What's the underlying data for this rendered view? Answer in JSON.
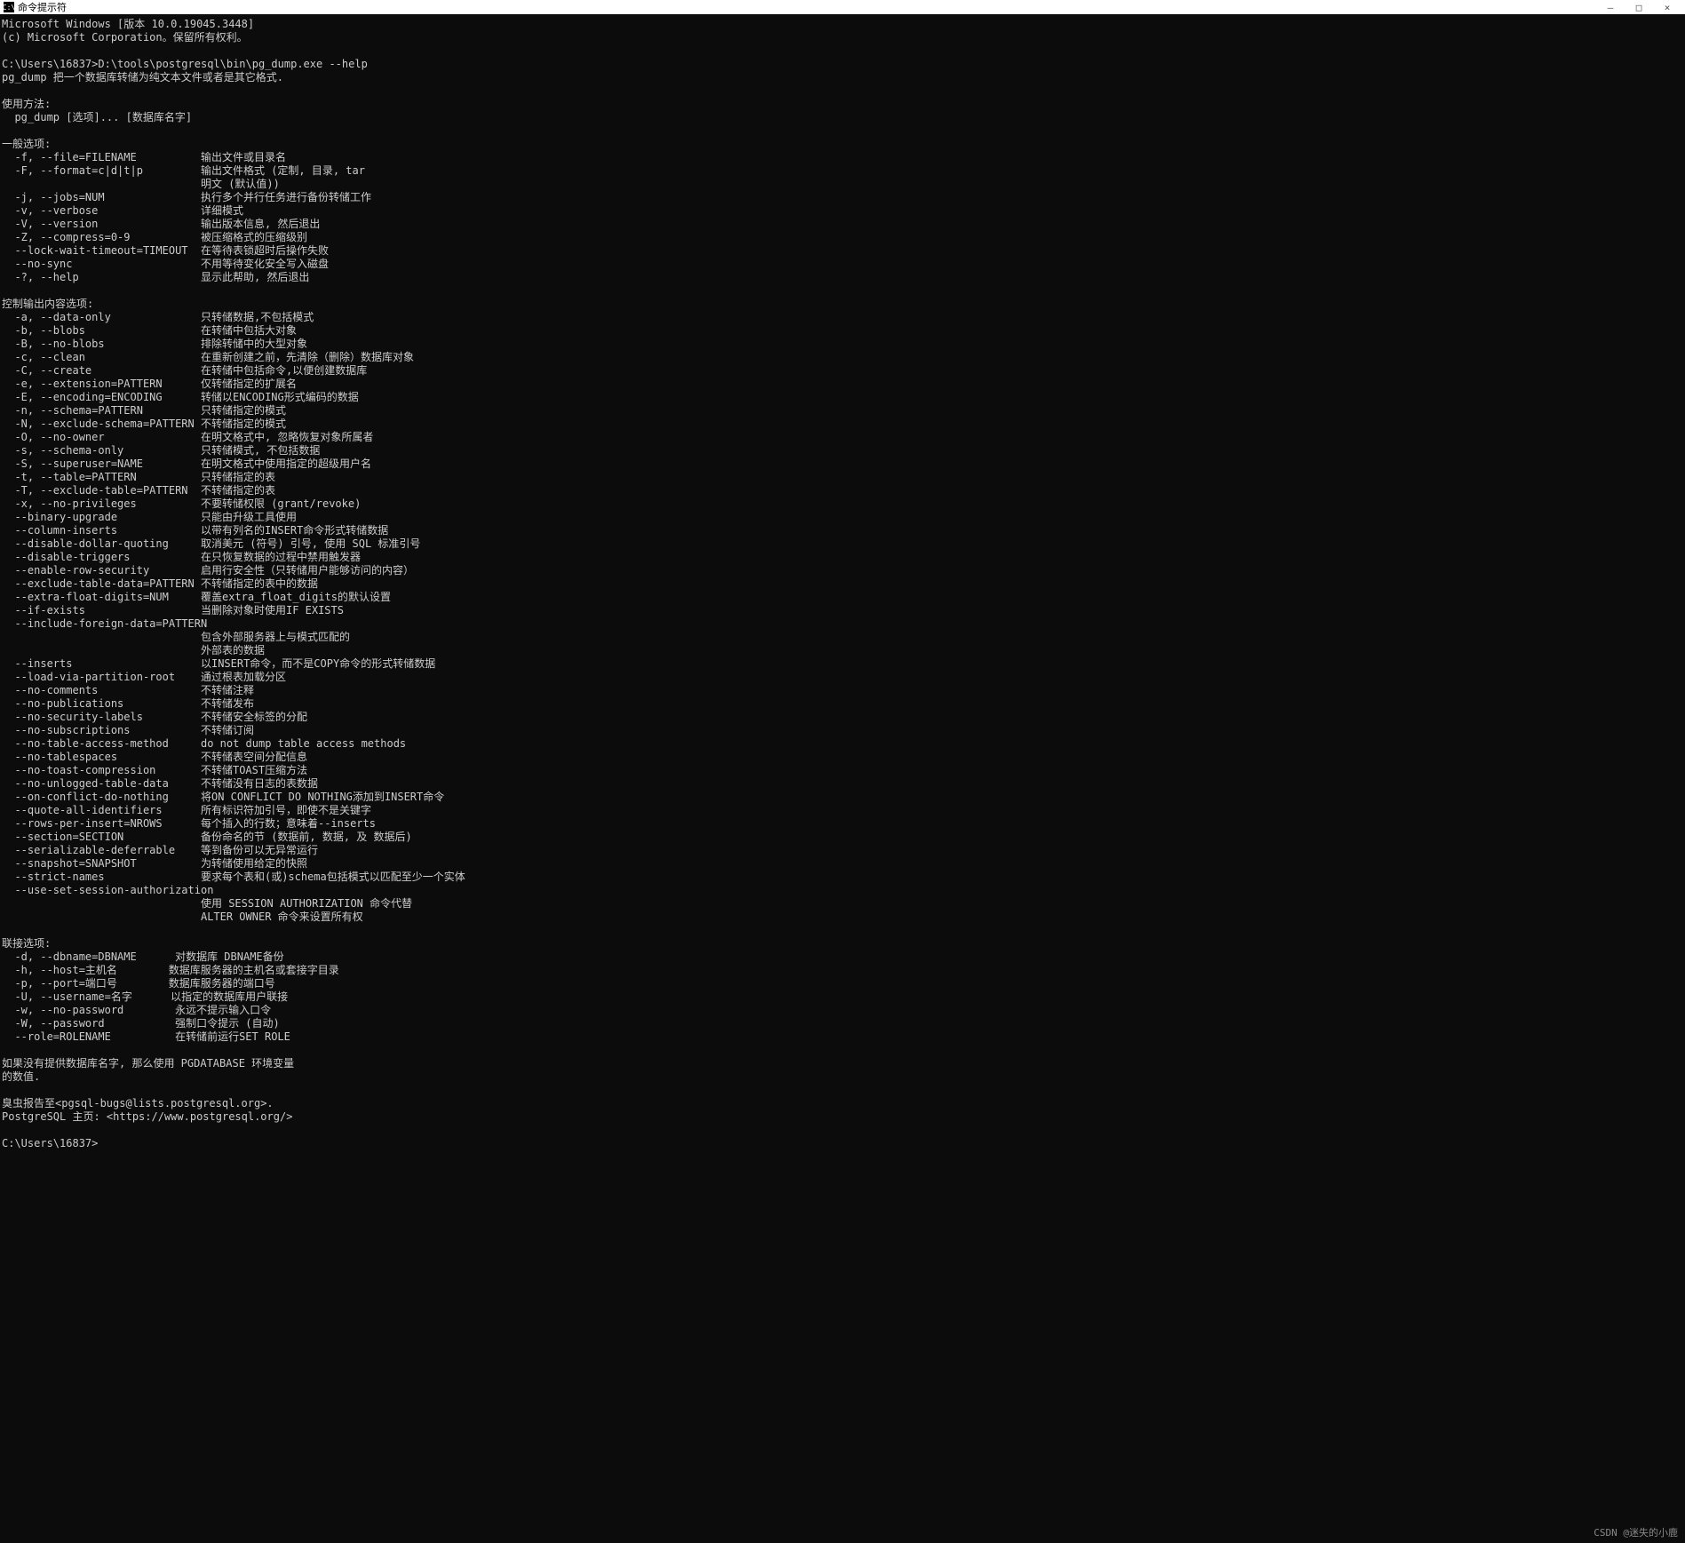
{
  "window": {
    "title": "命令提示符",
    "icon_label": "C:\\"
  },
  "controls": {
    "minimize": "—",
    "maximize": "□",
    "close": "×"
  },
  "lines": [
    "Microsoft Windows [版本 10.0.19045.3448]",
    "(c) Microsoft Corporation。保留所有权利。",
    "",
    "C:\\Users\\16837>D:\\tools\\postgresql\\bin\\pg_dump.exe --help",
    "pg_dump 把一个数据库转储为纯文本文件或者是其它格式.",
    "",
    "使用方法:",
    "  pg_dump [选项]... [数据库名字]",
    "",
    "一般选项:",
    "  -f, --file=FILENAME          输出文件或目录名",
    "  -F, --format=c|d|t|p         输出文件格式 (定制, 目录, tar",
    "                               明文 (默认值))",
    "  -j, --jobs=NUM               执行多个并行任务进行备份转储工作",
    "  -v, --verbose                详细模式",
    "  -V, --version                输出版本信息, 然后退出",
    "  -Z, --compress=0-9           被压缩格式的压缩级别",
    "  --lock-wait-timeout=TIMEOUT  在等待表锁超时后操作失败",
    "  --no-sync                    不用等待变化安全写入磁盘",
    "  -?, --help                   显示此帮助, 然后退出",
    "",
    "控制输出内容选项:",
    "  -a, --data-only              只转储数据,不包括模式",
    "  -b, --blobs                  在转储中包括大对象",
    "  -B, --no-blobs               排除转储中的大型对象",
    "  -c, --clean                  在重新创建之前，先清除（删除）数据库对象",
    "  -C, --create                 在转储中包括命令,以便创建数据库",
    "  -e, --extension=PATTERN      仅转储指定的扩展名",
    "  -E, --encoding=ENCODING      转储以ENCODING形式编码的数据",
    "  -n, --schema=PATTERN         只转储指定的模式",
    "  -N, --exclude-schema=PATTERN 不转储指定的模式",
    "  -O, --no-owner               在明文格式中, 忽略恢复对象所属者",
    "  -s, --schema-only            只转储模式, 不包括数据",
    "  -S, --superuser=NAME         在明文格式中使用指定的超级用户名",
    "  -t, --table=PATTERN          只转储指定的表",
    "  -T, --exclude-table=PATTERN  不转储指定的表",
    "  -x, --no-privileges          不要转储权限 (grant/revoke)",
    "  --binary-upgrade             只能由升级工具使用",
    "  --column-inserts             以带有列名的INSERT命令形式转储数据",
    "  --disable-dollar-quoting     取消美元 (符号) 引号, 使用 SQL 标准引号",
    "  --disable-triggers           在只恢复数据的过程中禁用触发器",
    "  --enable-row-security        启用行安全性（只转储用户能够访问的内容）",
    "  --exclude-table-data=PATTERN 不转储指定的表中的数据",
    "  --extra-float-digits=NUM     覆盖extra_float_digits的默认设置",
    "  --if-exists                  当删除对象时使用IF EXISTS",
    "  --include-foreign-data=PATTERN",
    "                               包含外部服务器上与模式匹配的",
    "                               外部表的数据",
    "  --inserts                    以INSERT命令，而不是COPY命令的形式转储数据",
    "  --load-via-partition-root    通过根表加载分区",
    "  --no-comments                不转储注释",
    "  --no-publications            不转储发布",
    "  --no-security-labels         不转储安全标签的分配",
    "  --no-subscriptions           不转储订阅",
    "  --no-table-access-method     do not dump table access methods",
    "  --no-tablespaces             不转储表空间分配信息",
    "  --no-toast-compression       不转储TOAST压缩方法",
    "  --no-unlogged-table-data     不转储没有日志的表数据",
    "  --on-conflict-do-nothing     将ON CONFLICT DO NOTHING添加到INSERT命令",
    "  --quote-all-identifiers      所有标识符加引号，即使不是关键字",
    "  --rows-per-insert=NROWS      每个插入的行数；意味着--inserts",
    "  --section=SECTION            备份命名的节 (数据前, 数据, 及 数据后)",
    "  --serializable-deferrable    等到备份可以无异常运行",
    "  --snapshot=SNAPSHOT          为转储使用给定的快照",
    "  --strict-names               要求每个表和(或)schema包括模式以匹配至少一个实体",
    "  --use-set-session-authorization",
    "                               使用 SESSION AUTHORIZATION 命令代替",
    "                               ALTER OWNER 命令来设置所有权",
    "",
    "联接选项:",
    "  -d, --dbname=DBNAME      对数据库 DBNAME备份",
    "  -h, --host=主机名        数据库服务器的主机名或套接字目录",
    "  -p, --port=端口号        数据库服务器的端口号",
    "  -U, --username=名字      以指定的数据库用户联接",
    "  -w, --no-password        永远不提示输入口令",
    "  -W, --password           强制口令提示 (自动)",
    "  --role=ROLENAME          在转储前运行SET ROLE",
    "",
    "如果没有提供数据库名字, 那么使用 PGDATABASE 环境变量",
    "的数值.",
    "",
    "臭虫报告至<pgsql-bugs@lists.postgresql.org>.",
    "PostgreSQL 主页: <https://www.postgresql.org/>",
    "",
    "C:\\Users\\16837>"
  ],
  "watermark": "CSDN @迷失的小鹿"
}
